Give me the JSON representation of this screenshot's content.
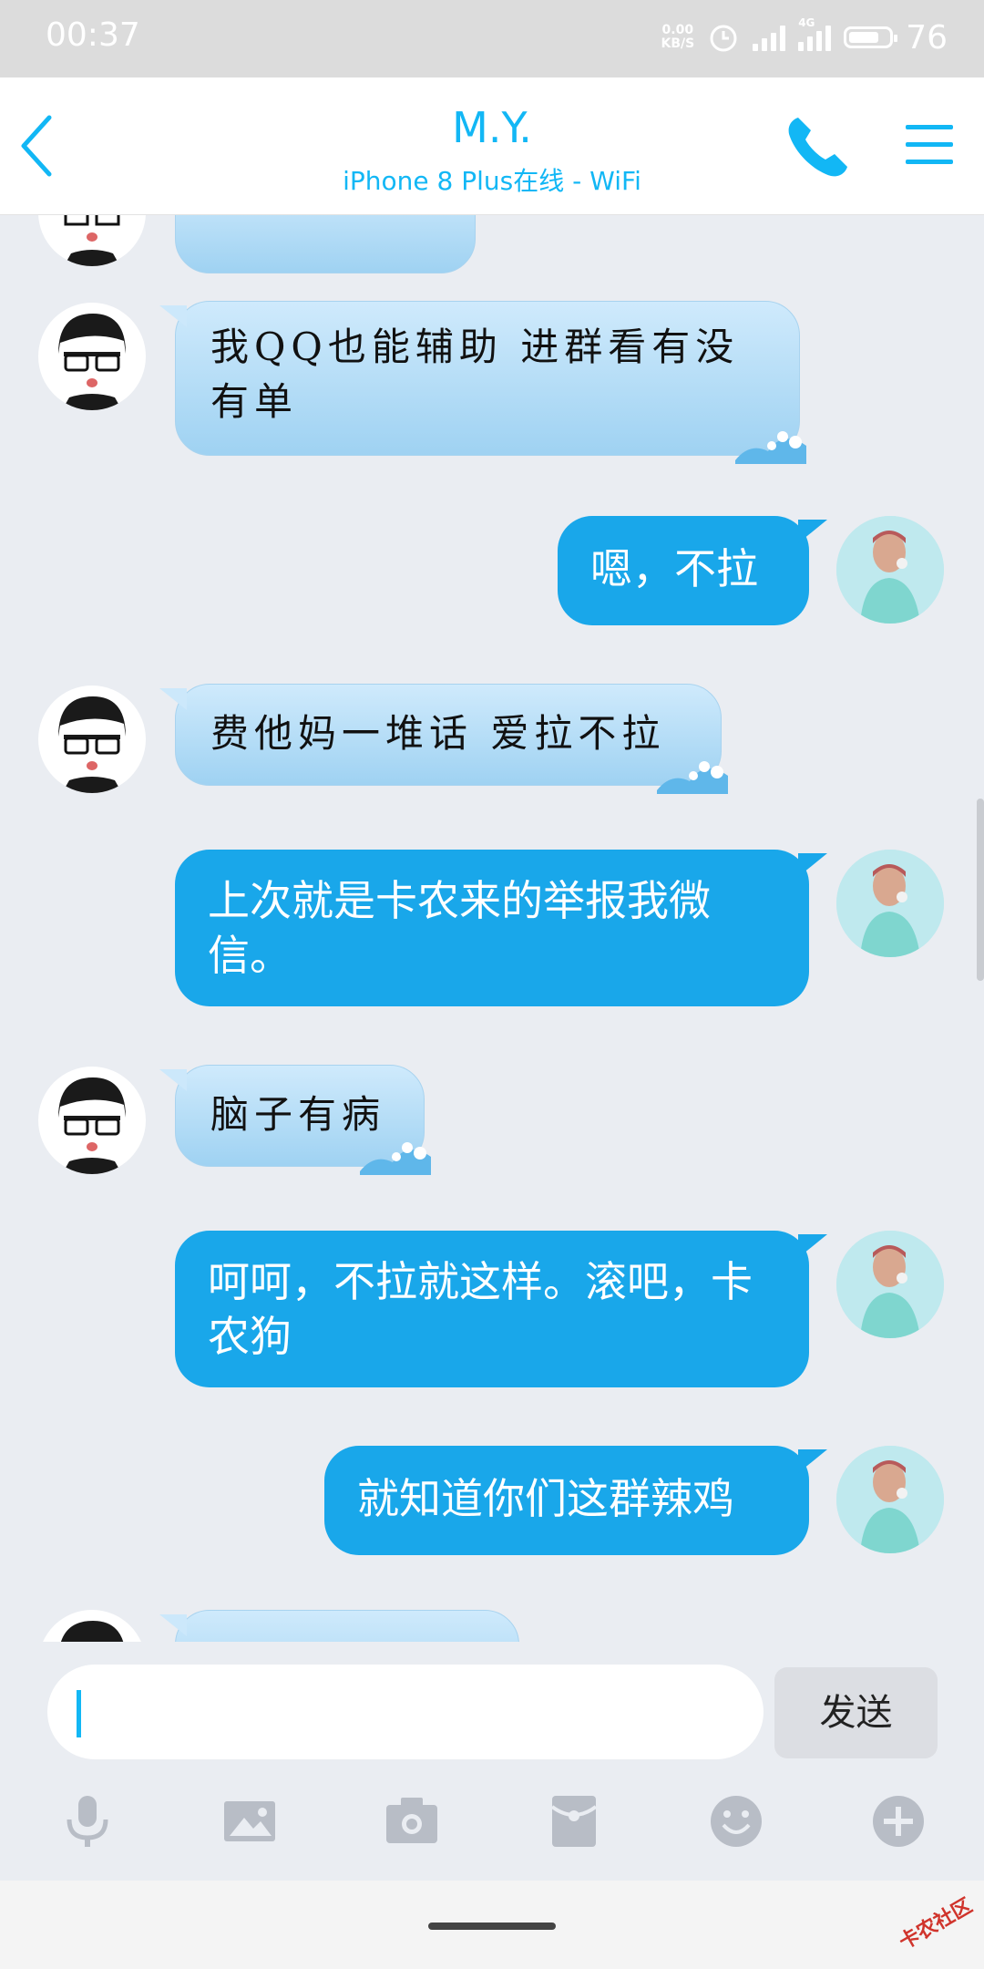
{
  "status_bar": {
    "time": "00:37",
    "net_speed_value": "0.00",
    "net_speed_unit": "KB/S",
    "network_type": "4G",
    "battery": "76"
  },
  "header": {
    "contact_name": "M.Y.",
    "contact_status": "iPhone 8 Plus在线 - WiFi"
  },
  "messages": [
    {
      "from": "other",
      "text": ""
    },
    {
      "from": "other",
      "text": "我QQ也能辅助  进群看有没有单"
    },
    {
      "from": "me",
      "text": "嗯，不拉"
    },
    {
      "from": "other",
      "text": "费他妈一堆话 爱拉不拉"
    },
    {
      "from": "me",
      "text": "上次就是卡农来的举报我微信。"
    },
    {
      "from": "other",
      "text": "脑子有病"
    },
    {
      "from": "me",
      "text": "呵呵，不拉就这样。滚吧，卡农狗"
    },
    {
      "from": "me",
      "text": "就知道你们这群辣鸡"
    },
    {
      "from": "other",
      "text": ""
    }
  ],
  "input": {
    "value": "",
    "send_label": "发送"
  },
  "toolbar": {
    "icons": [
      "microphone-icon",
      "image-icon",
      "camera-icon",
      "red-packet-icon",
      "emoji-icon",
      "plus-icon"
    ]
  },
  "watermark": "卡农社区",
  "colors": {
    "accent": "#12b7f5",
    "my_bubble": "#19a7ea",
    "other_bubble": "#b8defa",
    "background": "#eaedf2"
  }
}
